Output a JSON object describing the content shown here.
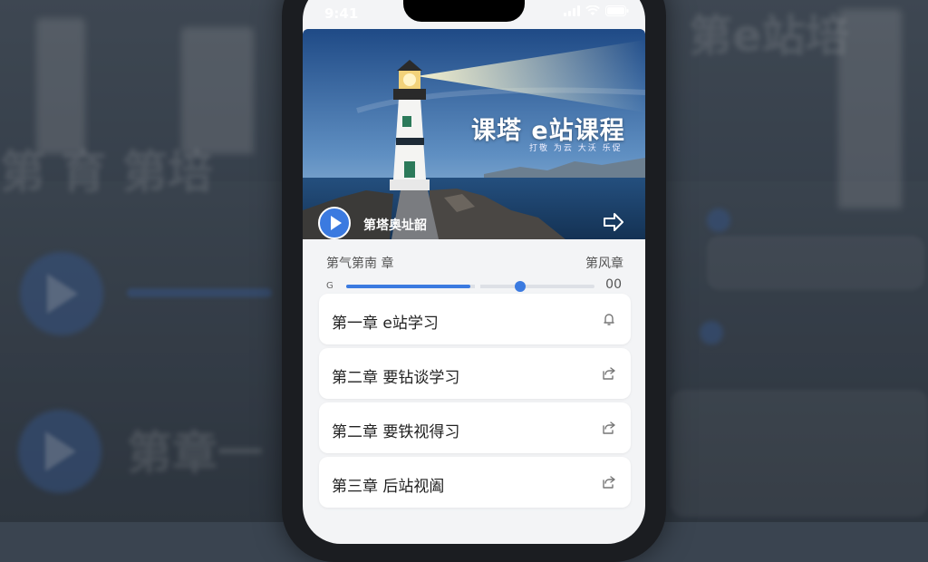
{
  "status": {
    "time": "9:41"
  },
  "hero": {
    "title": "课塔 e站课程",
    "subtitle": "打敬 为云 大沃 乐促",
    "now_playing": "第塔奥址韶"
  },
  "player": {
    "chapter_left": "第气第南 章",
    "chapter_right": "第风章",
    "start_icon": "G",
    "time": "00",
    "progress": 0.5,
    "buffered_gap": 0.52,
    "knob": 0.7
  },
  "chapters": [
    {
      "label": "第一章 e站学习",
      "icon": "bell-icon"
    },
    {
      "label": "第二章 要钻谈学习",
      "icon": "share-icon"
    },
    {
      "label": "第二章 要铁视得习",
      "icon": "share-icon"
    },
    {
      "label": "第三章 后站视阖",
      "icon": "share-icon"
    }
  ],
  "backdrop": {
    "text_top": "第e站培",
    "text_mid": "第 育 第培",
    "text_low": "第章一"
  },
  "colors": {
    "accent": "#3b7ae0"
  }
}
